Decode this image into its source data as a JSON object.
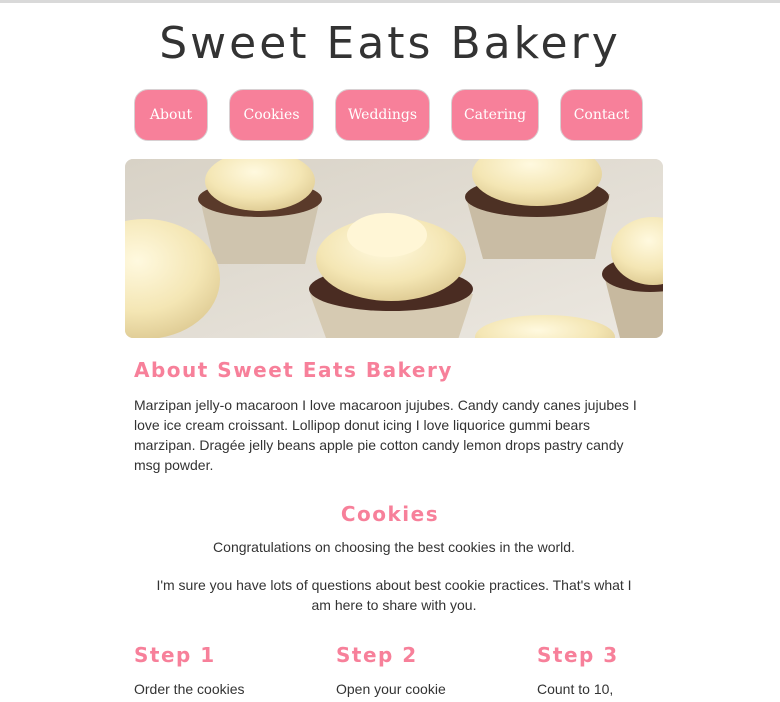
{
  "site": {
    "title": "Sweet Eats Bakery"
  },
  "nav": {
    "items": [
      {
        "label": "About"
      },
      {
        "label": "Cookies"
      },
      {
        "label": "Weddings"
      },
      {
        "label": "Catering"
      },
      {
        "label": "Contact"
      }
    ]
  },
  "hero": {
    "image": "cupcakes-with-cream-frosting"
  },
  "about": {
    "heading": "About Sweet Eats Bakery",
    "text": "Marzipan jelly-o macaroon I love macaroon jujubes. Candy candy canes jujubes I love ice cream croissant. Lollipop donut icing I love liquorice gummi bears marzipan. Dragée jelly beans apple pie cotton candy lemon drops pastry candy msg powder."
  },
  "cookies": {
    "heading": "Cookies",
    "paragraph1": "Congratulations on choosing the best cookies in the world.",
    "paragraph2": "I'm sure you have lots of questions about best cookie practices. That's what I am here to share with you."
  },
  "steps": [
    {
      "title": "Step 1",
      "text": "Order the cookies"
    },
    {
      "title": "Step 2",
      "text": "Open your cookie"
    },
    {
      "title": "Step 3",
      "text": "Count to 10,"
    }
  ],
  "colors": {
    "accent": "#f7809a",
    "text": "#333333",
    "background": "#ffffff"
  }
}
